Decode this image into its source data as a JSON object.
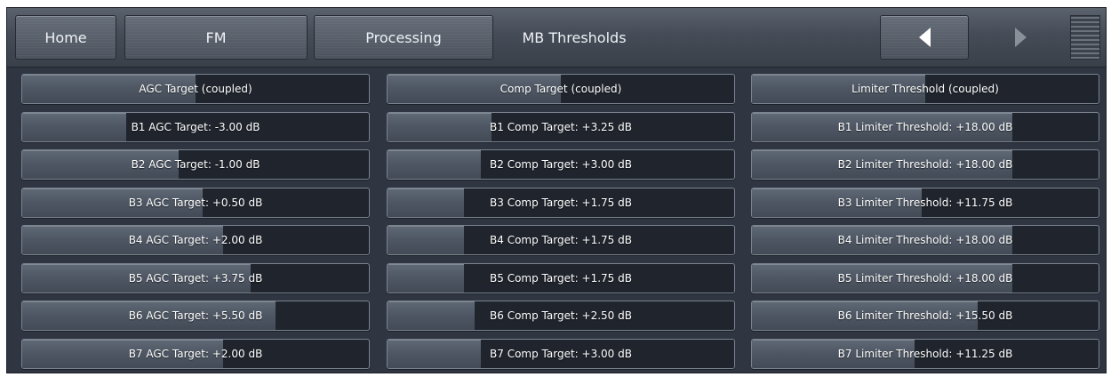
{
  "nav": {
    "home": "Home",
    "fm": "FM",
    "processing": "Processing",
    "current": "MB Thresholds",
    "left_icon": "triangle-left",
    "right_icon": "triangle-right",
    "menu_icon": "menu-lines"
  },
  "agc": [
    {
      "label": "AGC Target (coupled)",
      "level": 0.5
    },
    {
      "label": "B1 AGC Target: -3.00 dB",
      "level": 0.3
    },
    {
      "label": "B2 AGC Target: -1.00 dB",
      "level": 0.45
    },
    {
      "label": "B3 AGC Target: +0.50 dB",
      "level": 0.52
    },
    {
      "label": "B4 AGC Target: +2.00 dB",
      "level": 0.58
    },
    {
      "label": "B5 AGC Target: +3.75 dB",
      "level": 0.66
    },
    {
      "label": "B6 AGC Target: +5.50 dB",
      "level": 0.73
    },
    {
      "label": "B7 AGC Target: +2.00 dB",
      "level": 0.58
    }
  ],
  "comp": [
    {
      "label": "Comp Target (coupled)",
      "level": 0.5
    },
    {
      "label": "B1 Comp Target: +3.25 dB",
      "level": 0.3
    },
    {
      "label": "B2 Comp Target: +3.00 dB",
      "level": 0.27
    },
    {
      "label": "B3 Comp Target: +1.75 dB",
      "level": 0.22
    },
    {
      "label": "B4 Comp Target: +1.75 dB",
      "level": 0.22
    },
    {
      "label": "B5 Comp Target: +1.75 dB",
      "level": 0.22
    },
    {
      "label": "B6 Comp Target: +2.50 dB",
      "level": 0.25
    },
    {
      "label": "B7 Comp Target: +3.00 dB",
      "level": 0.27
    }
  ],
  "limiter": [
    {
      "label": "Limiter Threshold (coupled)",
      "level": 0.5
    },
    {
      "label": "B1 Limiter Threshold: +18.00 dB",
      "level": 0.75
    },
    {
      "label": "B2 Limiter Threshold: +18.00 dB",
      "level": 0.75
    },
    {
      "label": "B3 Limiter Threshold: +11.75 dB",
      "level": 0.49
    },
    {
      "label": "B4 Limiter Threshold: +18.00 dB",
      "level": 0.75
    },
    {
      "label": "B5 Limiter Threshold: +18.00 dB",
      "level": 0.75
    },
    {
      "label": "B6 Limiter Threshold: +15.50 dB",
      "level": 0.65
    },
    {
      "label": "B7 Limiter Threshold: +11.25 dB",
      "level": 0.47
    }
  ]
}
